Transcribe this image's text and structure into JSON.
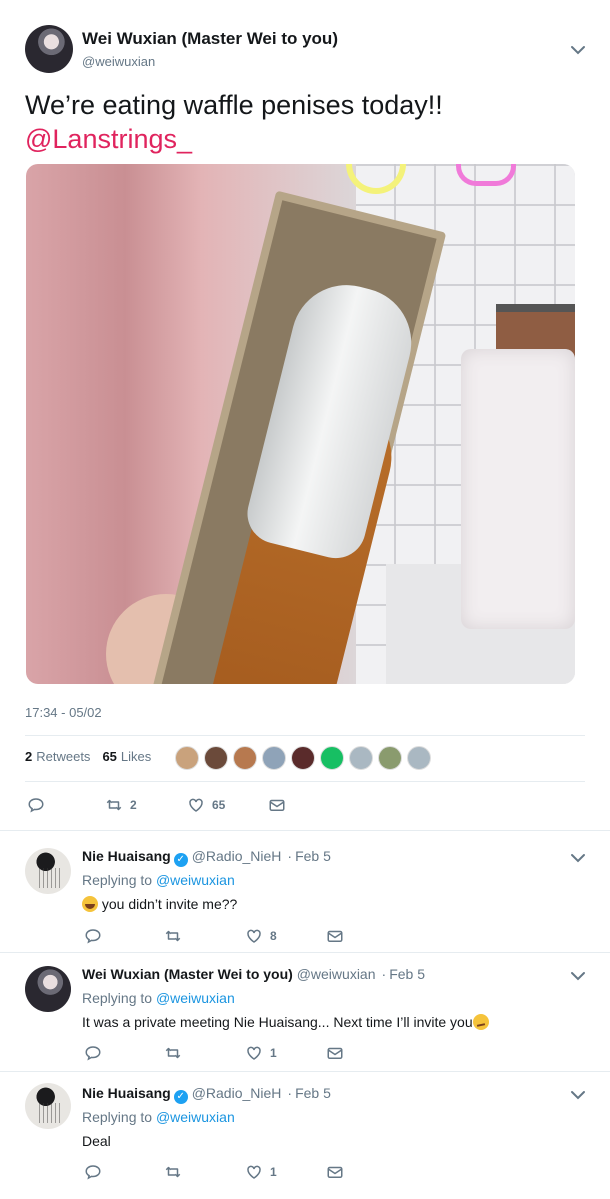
{
  "main_tweet": {
    "author_name": "Wei Wuxian (Master Wei to you)",
    "author_handle": "@weiwuxian",
    "text": "We’re eating waffle penises today!!",
    "mention": "@Lanstrings_",
    "timestamp": "17:34 - 05/02",
    "retweets_count": "2",
    "retweets_label": "Retweets",
    "likes_count": "65",
    "likes_label": "Likes",
    "liker_colors": [
      "#c9a27c",
      "#6b4a3a",
      "#b7794f",
      "#8fa3b8",
      "#5a2b2b",
      "#17bf63",
      "#aab8c2",
      "#8a9b6e",
      "#aab8c2"
    ],
    "actions": {
      "reply_count": "",
      "retweet_count": "2",
      "like_count": "65"
    }
  },
  "replies": [
    {
      "author_name": "Nie Huaisang",
      "verified": true,
      "author_handle": "@Radio_NieH",
      "date": "Feb 5",
      "replying_label": "Replying to",
      "replying_to": "@weiwuxian",
      "emoji_before": "laugh",
      "text": "you didn’t invite me??",
      "like_count": "8"
    },
    {
      "author_name": "Wei Wuxian (Master Wei to you)",
      "verified": false,
      "author_handle": "@weiwuxian",
      "date": "Feb 5",
      "replying_label": "Replying to",
      "replying_to": "@weiwuxian",
      "text": "It was a private meeting Nie Huaisang... Next time I’ll invite you",
      "emoji_after": "smirk",
      "like_count": "1"
    },
    {
      "author_name": "Nie Huaisang",
      "verified": true,
      "author_handle": "@Radio_NieH",
      "date": "Feb 5",
      "replying_label": "Replying to",
      "replying_to": "@weiwuxian",
      "text": "Deal",
      "like_count": "1"
    }
  ],
  "colors": {
    "accent": "#1da1f2",
    "mention": "#e0245e",
    "muted": "#657786"
  },
  "icons": [
    "reply-icon",
    "retweet-icon",
    "like-icon",
    "dm-icon",
    "chevron-down-icon",
    "verified-icon"
  ]
}
